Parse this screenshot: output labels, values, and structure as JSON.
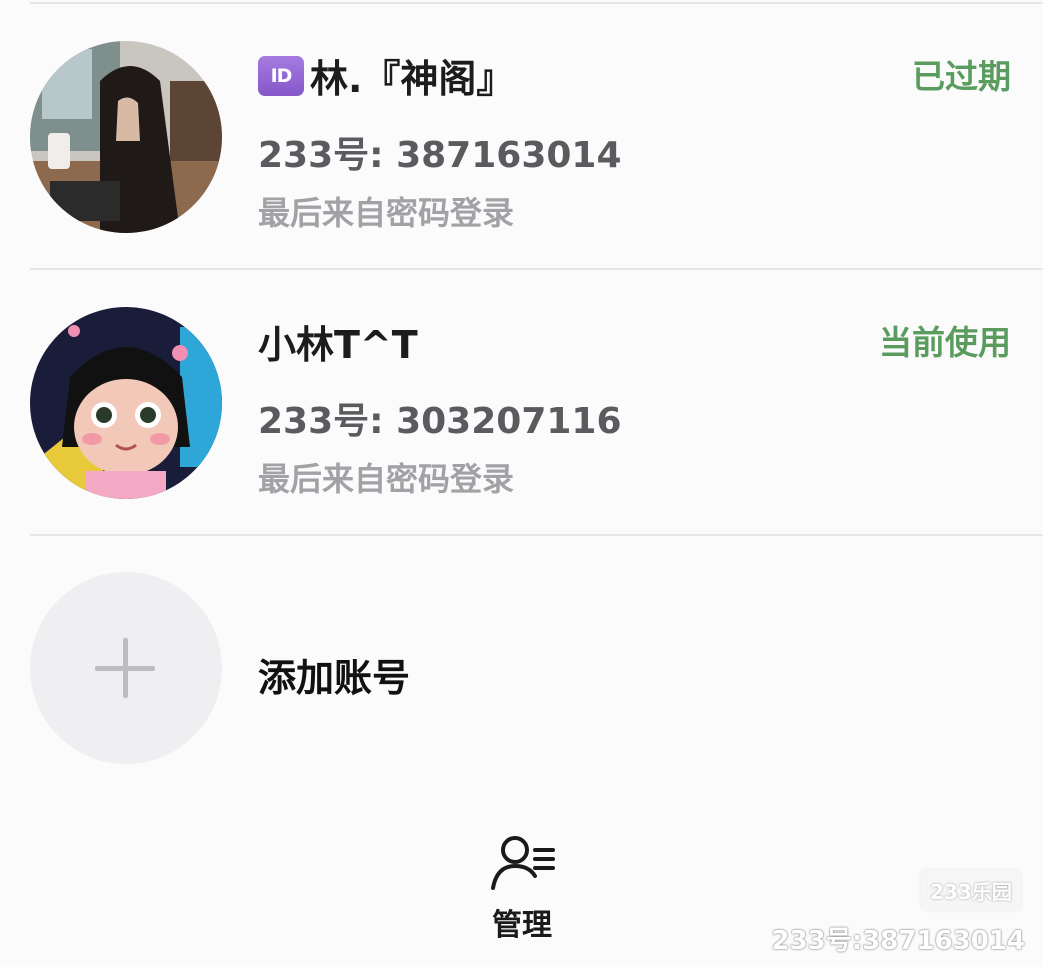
{
  "accounts": [
    {
      "id_badge": "ID",
      "name": "林.『神阁』",
      "uid": "233号: 387163014",
      "last_login": "最后来自密码登录",
      "status": "已过期",
      "status_color": "#5a9c5e"
    },
    {
      "name": "小林T^T",
      "uid": "233号: 303207116",
      "last_login": "最后来自密码登录",
      "status": "当前使用",
      "status_color": "#5a9c5e"
    }
  ],
  "add_account": {
    "label": "添加账号",
    "icon": "plus-icon"
  },
  "bottom_nav": {
    "manage_label": "管理",
    "icon": "user-list-icon"
  },
  "watermark": {
    "logo": "233乐园",
    "text": "233号:387163014"
  }
}
